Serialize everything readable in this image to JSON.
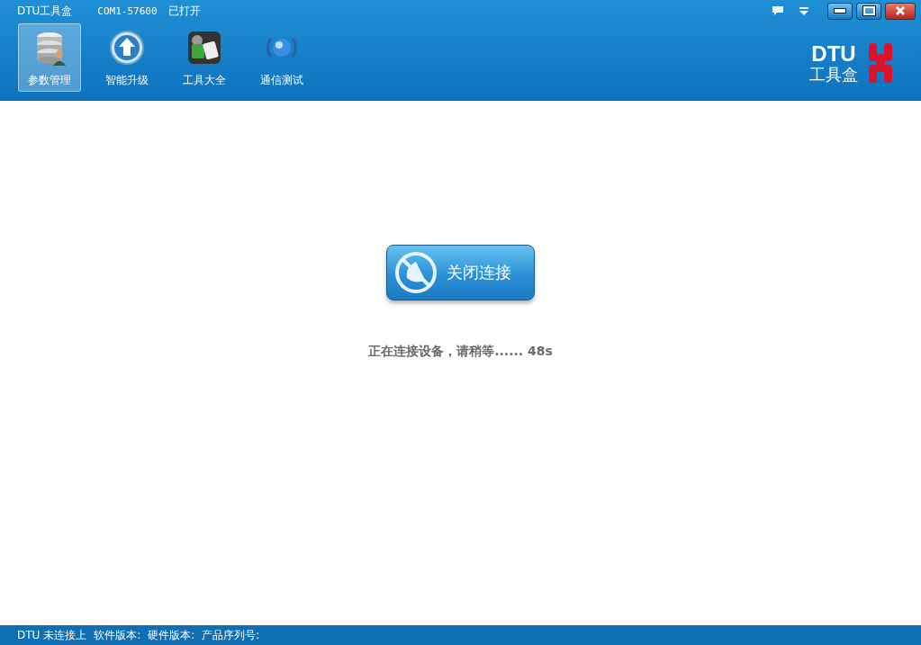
{
  "window": {
    "title": "DTU工具盒",
    "port": "COM1-57600",
    "port_state": "已打开"
  },
  "toolbar": [
    {
      "label": "参数管理",
      "kind": "database",
      "selected": true
    },
    {
      "label": "智能升级",
      "kind": "upgrade",
      "selected": false
    },
    {
      "label": "工具大全",
      "kind": "tools",
      "selected": false
    },
    {
      "label": "通信测试",
      "kind": "globe",
      "selected": false
    }
  ],
  "logo": {
    "line1": "DTU",
    "line2": "工具盒"
  },
  "main": {
    "button": "关闭连接",
    "message": "正在连接设备，请稍等...... 48s"
  },
  "status_bar": [
    "DTU 未连接上",
    "软件版本:",
    "硬件版本:",
    "产品序列号:"
  ]
}
